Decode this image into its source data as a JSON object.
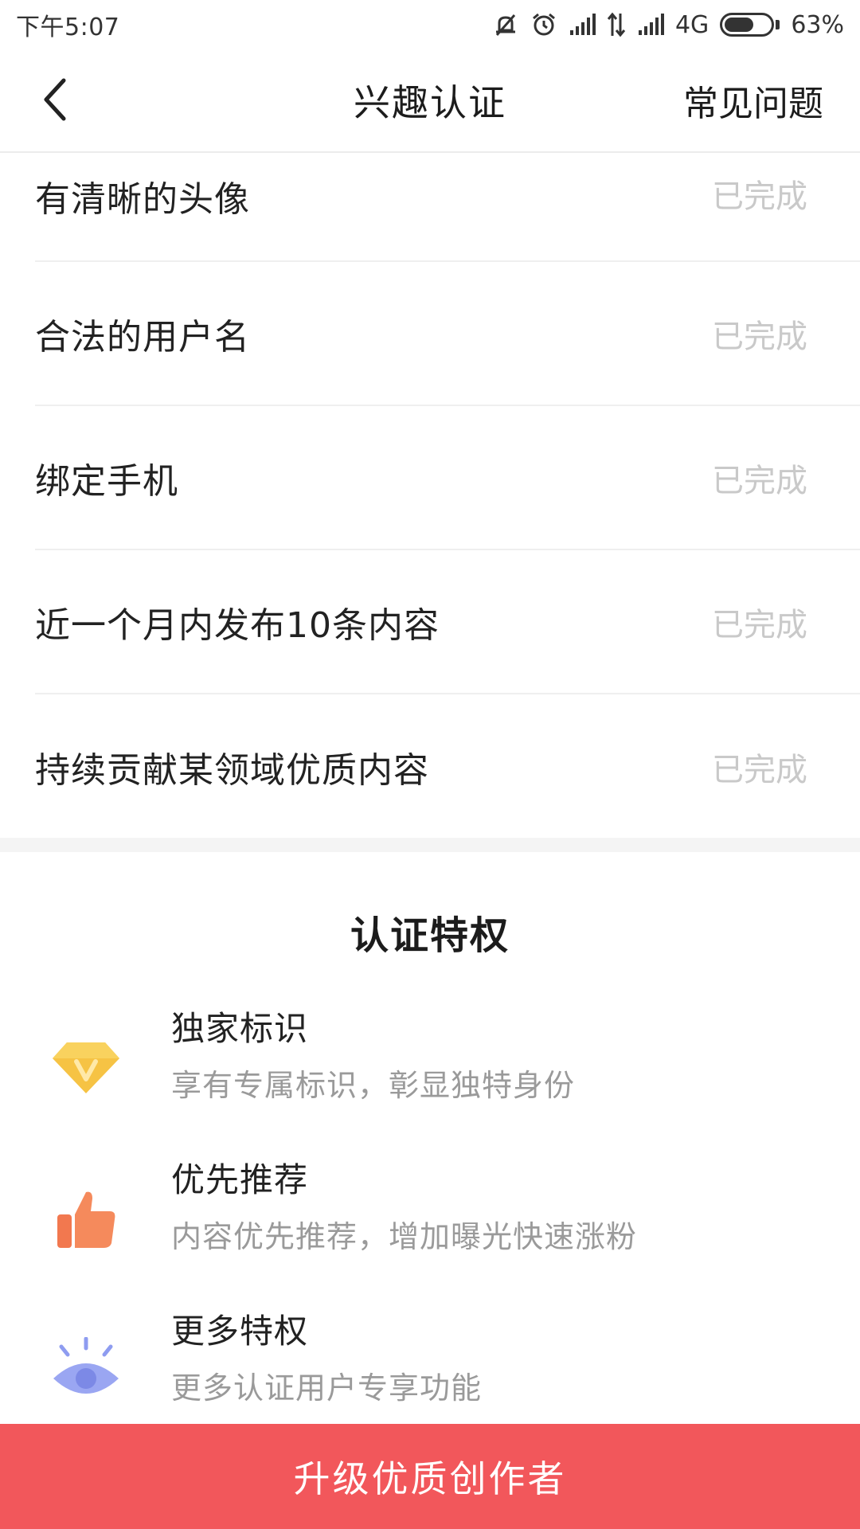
{
  "status_bar": {
    "time": "下午5:07",
    "network": "4G",
    "battery_percent": "63%",
    "battery_level": 0.63,
    "icons": [
      "mute-icon",
      "alarm-icon",
      "signal-icon",
      "data-transfer-icon",
      "signal-icon",
      "battery-icon"
    ]
  },
  "nav": {
    "title": "兴趣认证",
    "faq_label": "常见问题",
    "back_icon": "chevron-left-icon"
  },
  "requirements": [
    {
      "label": "有清晰的头像",
      "status": "已完成"
    },
    {
      "label": "合法的用户名",
      "status": "已完成"
    },
    {
      "label": "绑定手机",
      "status": "已完成"
    },
    {
      "label": "近一个月内发布10条内容",
      "status": "已完成"
    },
    {
      "label": "持续贡献某领域优质内容",
      "status": "已完成"
    }
  ],
  "privileges": {
    "title": "认证特权",
    "items": [
      {
        "icon": "diamond-badge-icon",
        "name": "独家标识",
        "desc": "享有专属标识，彰显独特身份",
        "color": "#f6c344"
      },
      {
        "icon": "thumbs-up-icon",
        "name": "优先推荐",
        "desc": "内容优先推荐，增加曝光快速涨粉",
        "color": "#f2784f"
      },
      {
        "icon": "eye-icon",
        "name": "更多特权",
        "desc": "更多认证用户专享功能",
        "color": "#8e9cf0"
      }
    ]
  },
  "cta": {
    "label": "升级优质创作者",
    "color": "#f2575b"
  }
}
